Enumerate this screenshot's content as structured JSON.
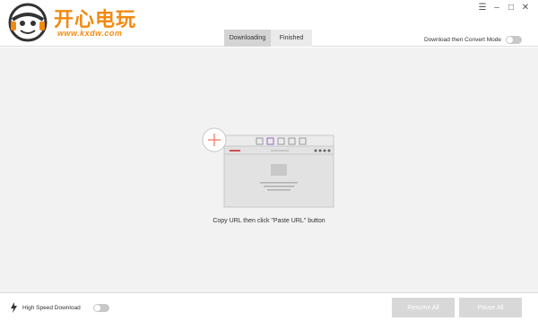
{
  "app": {
    "logo_text": "开心电玩",
    "logo_url": "www.kxdw.com"
  },
  "window_controls": [
    {
      "icon": "menu-icon",
      "glyph": "☰"
    },
    {
      "icon": "minimize-icon",
      "glyph": "–"
    },
    {
      "icon": "maximize-icon",
      "glyph": "□"
    },
    {
      "icon": "close-icon",
      "glyph": "✕"
    }
  ],
  "tabs": [
    {
      "label": "Downloading",
      "active": true
    },
    {
      "label": "Finished",
      "active": false
    }
  ],
  "mode": {
    "label": "Download then Convert Mode",
    "enabled": false
  },
  "main": {
    "hint": "Copy URL then click \"Paste URL\" button"
  },
  "footer": {
    "high_speed_label": "High Speed Download",
    "high_speed_enabled": false,
    "resume_label": "Resume All",
    "pause_label": "Pause All"
  },
  "colors": {
    "brand": "#f28a10",
    "accent_plus": "#f08a7a",
    "accent_tab": "#a07cc8"
  }
}
